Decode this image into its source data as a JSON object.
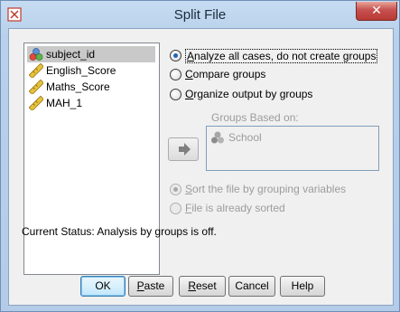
{
  "window": {
    "title": "Split File",
    "close_label": "✕"
  },
  "variables": [
    {
      "label": "subject_id",
      "icon": "nominal-variable-icon",
      "selected": true
    },
    {
      "label": "English_Score",
      "icon": "scale-variable-icon",
      "selected": false
    },
    {
      "label": "Maths_Score",
      "icon": "scale-variable-icon",
      "selected": false
    },
    {
      "label": "MAH_1",
      "icon": "scale-variable-icon",
      "selected": false
    }
  ],
  "options": {
    "analyze_all": {
      "label_key": "A",
      "label_rest": "nalyze all cases, do not create groups",
      "checked": true
    },
    "compare": {
      "label_key": "C",
      "label_rest": "ompare groups",
      "checked": false
    },
    "organize": {
      "label_key": "O",
      "label_rest": "rganize output by groups",
      "checked": false
    }
  },
  "groups": {
    "label": "Groups Based on:",
    "items": [
      {
        "label": "School",
        "icon": "nominal-variable-icon"
      }
    ]
  },
  "sort": {
    "sort_by_group": {
      "label_key": "S",
      "label_rest": "ort the file by grouping variables",
      "checked": true
    },
    "already_sorted": {
      "label_key": "F",
      "label_rest": "ile is already sorted",
      "checked": false
    }
  },
  "status_text": "Current Status: Analysis by groups is off.",
  "buttons": {
    "ok": "OK",
    "paste_key": "P",
    "paste_rest": "aste",
    "reset_key": "R",
    "reset_rest": "eset",
    "cancel": "Cancel",
    "help": "Help"
  },
  "colors": {
    "accent": "#1e63b8",
    "disabled_text": "#9c9c9c",
    "close_button": "#c75050"
  }
}
